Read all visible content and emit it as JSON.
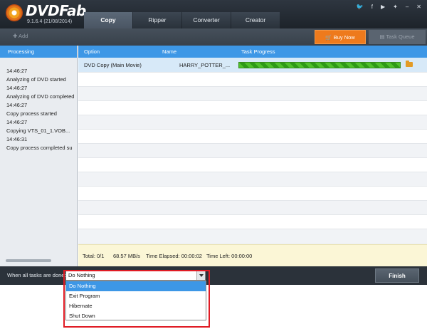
{
  "app": {
    "logo_text": "DVDFab",
    "version": "9.1.6.4 (21/08/2014)"
  },
  "tabs": [
    {
      "label": "Copy",
      "active": true
    },
    {
      "label": "Ripper",
      "active": false
    },
    {
      "label": "Converter",
      "active": false
    },
    {
      "label": "Creator",
      "active": false
    }
  ],
  "social": [
    "twitter-icon",
    "facebook-icon",
    "youtube-icon",
    "settings-icon",
    "minimize-icon",
    "close-icon"
  ],
  "social_glyphs": [
    "🐦",
    "f",
    "▶",
    "✦",
    "–",
    "✕"
  ],
  "toolbar": {
    "add_label": "Add",
    "buy_label": "Buy Now",
    "queue_label": "Task Queue"
  },
  "left_panel": {
    "header": "Processing",
    "log": [
      "14:46:27",
      "Analyzing of DVD started",
      "14:46:27",
      "Analyzing of DVD completed",
      "14:46:27",
      "Copy process started",
      "14:46:27",
      "Copying VTS_01_1.VOB...",
      "14:46:31",
      "Copy process completed su"
    ]
  },
  "table": {
    "columns": {
      "option": "Option",
      "name": "Name",
      "progress": "Task Progress"
    },
    "task": {
      "option": "DVD Copy (Main Movie)",
      "name": "HARRY_POTTER_...",
      "progress": 1.0
    }
  },
  "status": {
    "total": "Total: 0/1",
    "speed": "68.57 MB/s",
    "elapsed": "Time Elapsed: 00:00:02",
    "left": "Time Left: 00:00:00"
  },
  "bottom": {
    "when_label": "When all tasks are done:",
    "selected": "Do Nothing",
    "options": [
      "Do Nothing",
      "Exit Program",
      "Hibernate",
      "Shut Down"
    ],
    "finish_label": "Finish"
  },
  "colors": {
    "accent": "#3d97e6",
    "buy": "#ee7a1c",
    "highlight": "#e01b24",
    "progress": "#4fc12c"
  }
}
